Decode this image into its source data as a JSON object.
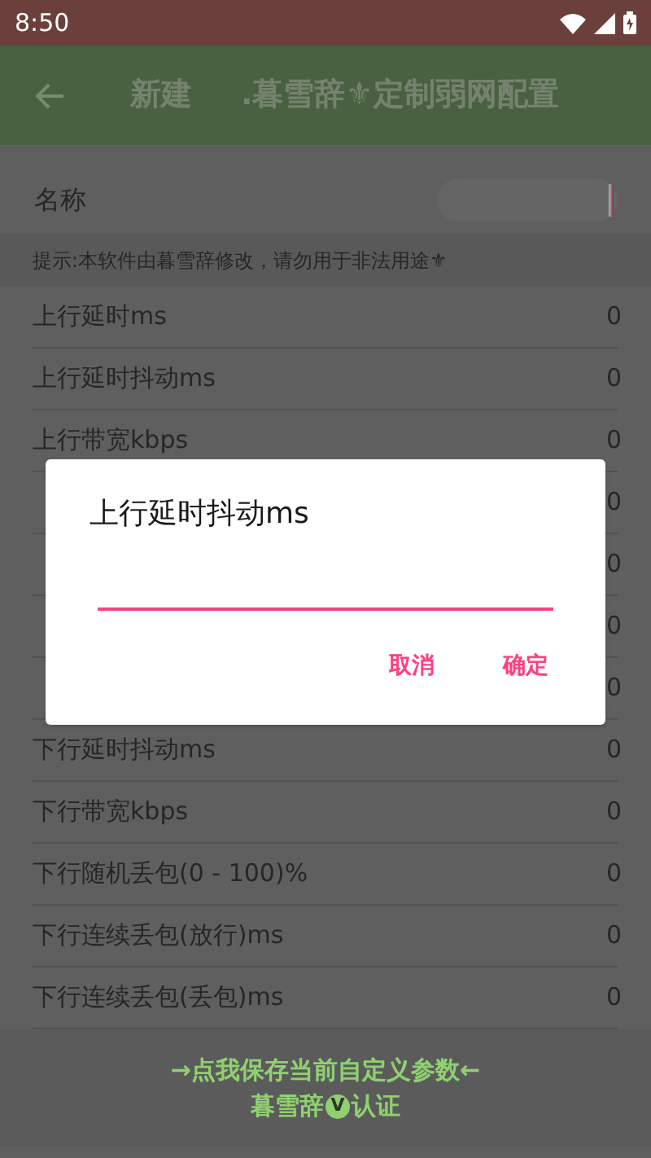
{
  "status_bar": {
    "time": "8:50"
  },
  "app_bar": {
    "title_left": "新建",
    "title": ".暮雪辞⚜定制弱网配置"
  },
  "name_field": {
    "label": "名称"
  },
  "hint": "提示:本软件由暮雪辞修改，请勿用于非法用途⚜",
  "rows": [
    {
      "label": "上行延时ms",
      "value": "0"
    },
    {
      "label": "上行延时抖动ms",
      "value": "0"
    },
    {
      "label": "上行带宽kbps",
      "value": "0"
    },
    {
      "value": "0"
    },
    {
      "value": "0"
    },
    {
      "value": "0"
    },
    {
      "value": "0"
    },
    {
      "label": "下行延时抖动ms",
      "value": "0"
    },
    {
      "label": "下行带宽kbps",
      "value": "0"
    },
    {
      "label": "下行随机丢包(0 - 100)%",
      "value": "0"
    },
    {
      "label": "下行连续丢包(放行)ms",
      "value": "0"
    },
    {
      "label": "下行连续丢包(丢包)ms",
      "value": "0"
    }
  ],
  "save_bar": {
    "line1": "→点我保存当前自定义参数←",
    "line2_a": "暮雪辞",
    "badge": "V",
    "line2_b": "认证"
  },
  "dialog": {
    "title": "上行延时抖动ms",
    "buttons": [
      "取消",
      "确定"
    ]
  }
}
